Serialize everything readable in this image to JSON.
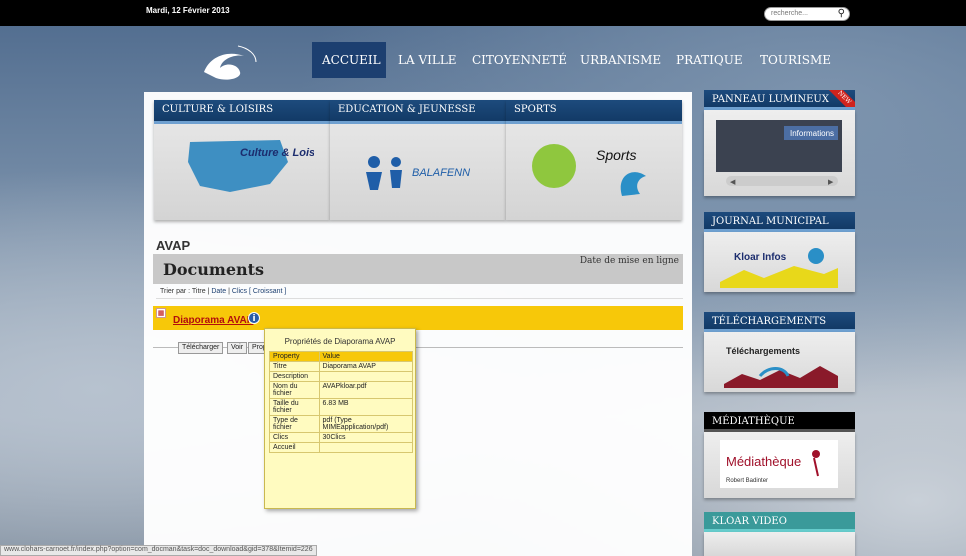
{
  "topbar": {
    "date": "Mardi, 12 Février 2013",
    "search_placeholder": "recherche..."
  },
  "nav": [
    "ACCUEIL",
    "LA VILLE",
    "CITOYENNETÉ",
    "URBANISME",
    "PRATIQUE",
    "TOURISME"
  ],
  "categories": [
    {
      "title": "CULTURE & LOISIRS",
      "image_text": "Culture & Loisirs"
    },
    {
      "title": "EDUCATION & JEUNESSE",
      "image_text": "BALAFENN"
    },
    {
      "title": "SPORTS",
      "image_text": "Sports"
    }
  ],
  "page": {
    "heading": "AVAP",
    "section_title": "Documents",
    "date_header": "Date de mise en ligne",
    "sort_prefix": "Trier par : Titre |",
    "sort_date": "Date",
    "sort_sep": "|",
    "sort_clics": "Clics",
    "sort_order": "[ Croissant ]"
  },
  "document": {
    "title": "Diaporama AVAP",
    "buttons": [
      "Télécharger",
      "Voir",
      "Prop"
    ]
  },
  "tooltip": {
    "title": "Propriétés de Diaporama AVAP",
    "headers": [
      "Property",
      "Value"
    ],
    "rows": [
      [
        "Titre",
        "Diaporama AVAP"
      ],
      [
        "Description",
        ""
      ],
      [
        "Nom du fichier",
        "AVAPkloar.pdf"
      ],
      [
        "Taille du fichier",
        "6.83 MB"
      ],
      [
        "Type de fichier",
        "pdf (Type MIMEapplication/pdf)"
      ],
      [
        "Clics",
        "30Clics"
      ],
      [
        "Accueil",
        ""
      ]
    ]
  },
  "sidebar": [
    {
      "title": "PANNEAU LUMINEUX",
      "ribbon": "NEW",
      "image_text": "Informations"
    },
    {
      "title": "JOURNAL MUNICIPAL",
      "image_text": "Kloar Infos"
    },
    {
      "title": "TÉLÉCHARGEMENTS",
      "image_text": "Téléchargements"
    },
    {
      "title": "MÉDIATHÈQUE",
      "image_text": "Médiathèque",
      "image_sub": "Robert Badinter"
    },
    {
      "title": "KLOAR VIDEO"
    }
  ],
  "statusbar": "www.clohars-carnoet.fr/index.php?option=com_docman&task=doc_download&gid=378&Itemid=226",
  "colors": {
    "nav_active": "#1c3f70",
    "highlight": "#f7c809",
    "tooltip_bg": "#fffbc0"
  }
}
